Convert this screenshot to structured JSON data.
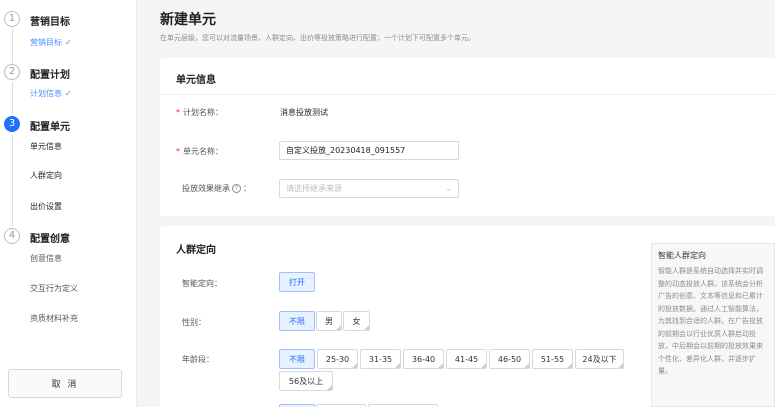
{
  "sidebar": {
    "steps": [
      {
        "num": "1",
        "title": "营销目标",
        "sub": "营销目标"
      },
      {
        "num": "2",
        "title": "配置计划",
        "sub": "计划信息"
      },
      {
        "num": "3",
        "title": "配置单元",
        "items": [
          "单元信息",
          "人群定向",
          "出价设置"
        ]
      },
      {
        "num": "4",
        "title": "配置创意",
        "items": [
          "创意信息",
          "交互行为定义",
          "资质材料补充"
        ]
      }
    ],
    "cancel_label": "取 消"
  },
  "header": {
    "title": "新建单元",
    "desc": "在单元层级，您可以对流量场景、人群定向、出价等投放策略进行配置；一个计划下可配置多个单元。"
  },
  "unit_info": {
    "title": "单元信息",
    "plan_name_label": "计划名称：",
    "plan_name_value": "消息投放测试",
    "unit_name_label": "单元名称：",
    "unit_name_value": "自定义投放_20230418_091557",
    "inherit_label": "投放效果继承",
    "inherit_placeholder": "请选择继承来源"
  },
  "targeting": {
    "title": "人群定向",
    "smart_label": "智能定向：",
    "smart_button": "打开",
    "gender_label": "性别：",
    "gender_options": [
      "不限",
      "男",
      "女"
    ],
    "age_label": "年龄段：",
    "age_options": [
      "不限",
      "25-30",
      "31-35",
      "36-40",
      "41-45",
      "46-50",
      "51-55",
      "24及以下",
      "56及以上"
    ]
  },
  "tip": {
    "title": "智能人群定向",
    "body": "智能人群是系统自动选择并实时调整的动态投放人群。该系统会分析广告的创意、文本等信息和已累计的投放数据。通过人工智能算法，为其找到合适的人群。在广告投放的前期会以行业优质人群启动投放，中后期会以前期的投放效果来个性化、差异化人群，并逐步扩量。"
  },
  "colors": {
    "primary": "#1e6fff",
    "required": "#f5222d"
  }
}
